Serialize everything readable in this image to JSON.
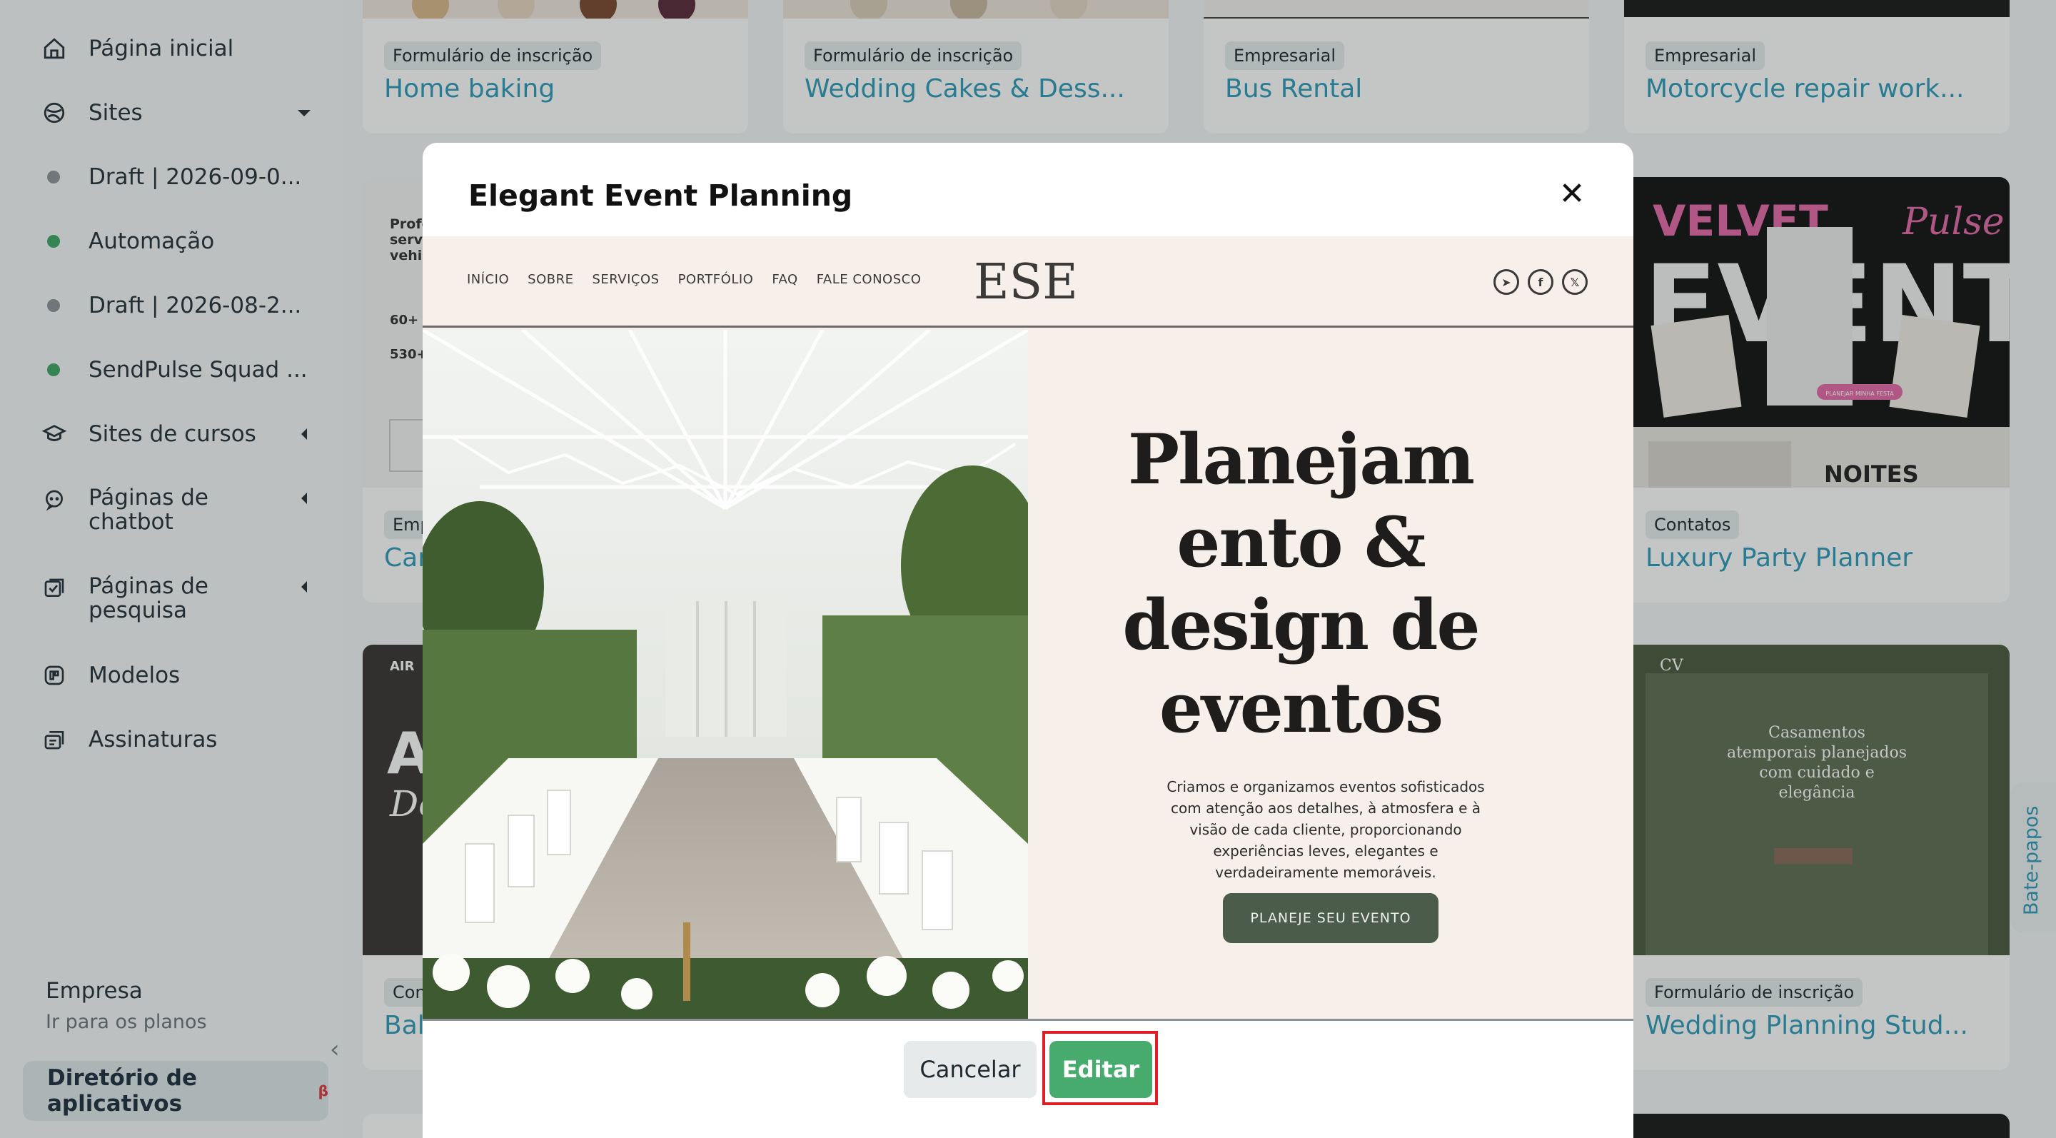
{
  "sidebar": {
    "items": [
      {
        "label": "Página inicial",
        "icon": "home-icon"
      },
      {
        "label": "Sites",
        "icon": "globe-icon"
      },
      {
        "label": "Draft | 2026-09-0...",
        "status_color": "#8e9497"
      },
      {
        "label": "Automação",
        "status_color": "#3fa866"
      },
      {
        "label": "Draft | 2026-08-2...",
        "status_color": "#8e9497"
      },
      {
        "label": "SendPulse Squad ...",
        "status_color": "#3fa866"
      },
      {
        "label": "Sites de cursos",
        "icon": "graduation-cap-icon"
      },
      {
        "label": "Páginas de chatbot",
        "icon": "chat-icon"
      },
      {
        "label": "Páginas de pesquisa",
        "icon": "survey-icon"
      },
      {
        "label": "Modelos",
        "icon": "template-icon"
      },
      {
        "label": "Assinaturas",
        "icon": "subscriptions-icon"
      }
    ],
    "company": {
      "name": "Empresa",
      "link": "Ir para os planos"
    },
    "app_directory": {
      "label": "Diretório de aplicativos",
      "badge": "β"
    }
  },
  "cards": [
    {
      "tag": "Formulário de inscrição",
      "title": "Home baking"
    },
    {
      "tag": "Formulário de inscrição",
      "title": "Wedding Cakes & Dess..."
    },
    {
      "tag": "Empresarial",
      "title": "Bus Rental"
    },
    {
      "tag": "Empresarial",
      "title": "Motorcycle repair work..."
    },
    {
      "tag": "Emp",
      "title": "Car"
    },
    {
      "tag": "Contatos",
      "title": "Luxury Party Planner"
    },
    {
      "tag": "Con",
      "title": "Bal"
    },
    {
      "tag": "Formulário de inscrição",
      "title": "Wedding Planning Stud..."
    }
  ],
  "thumbs": {
    "velvet": {
      "line1": "VELVET",
      "line2": "EVENTS",
      "script": "Pulse",
      "pill": "PLANEJAR MINHA FESTA",
      "footer": "NOITES"
    },
    "car_partial": {
      "lines": [
        "Profe",
        "servi",
        "vehic"
      ],
      "stat1": "60+",
      "stat2": "530+"
    },
    "air_partial": {
      "brand": "AIR",
      "big": "AI",
      "script": "De"
    },
    "wedding_venue": {
      "logo": "CV",
      "headline": "Casamentos atemporais planejados com cuidado e elegância"
    }
  },
  "modal": {
    "title": "Elegant Event Planning",
    "close_icon": "close-icon",
    "preview": {
      "nav_links": [
        "INÍCIO",
        "SOBRE",
        "SERVIÇOS",
        "PORTFÓLIO",
        "FAQ",
        "FALE CONOSCO"
      ],
      "logo": "ESE",
      "social_icons": [
        "telegram-icon",
        "facebook-icon",
        "x-icon"
      ],
      "headline": "Planejam ento & design de eventos",
      "body": "Criamos e organizamos eventos sofisticados com atenção aos detalhes, à atmosfera e à visão de cada cliente, proporcionando experiências leves, elegantes e verdadeiramente memoráveis.",
      "cta": "PLANEJE SEU EVENTO"
    },
    "cancel_label": "Cancelar",
    "edit_label": "Editar"
  },
  "chat_tab": {
    "label": "Bate-papos"
  },
  "colors": {
    "accent": "#2e9ab8",
    "primary_button": "#47ab6e",
    "highlight": "#e01d25"
  }
}
